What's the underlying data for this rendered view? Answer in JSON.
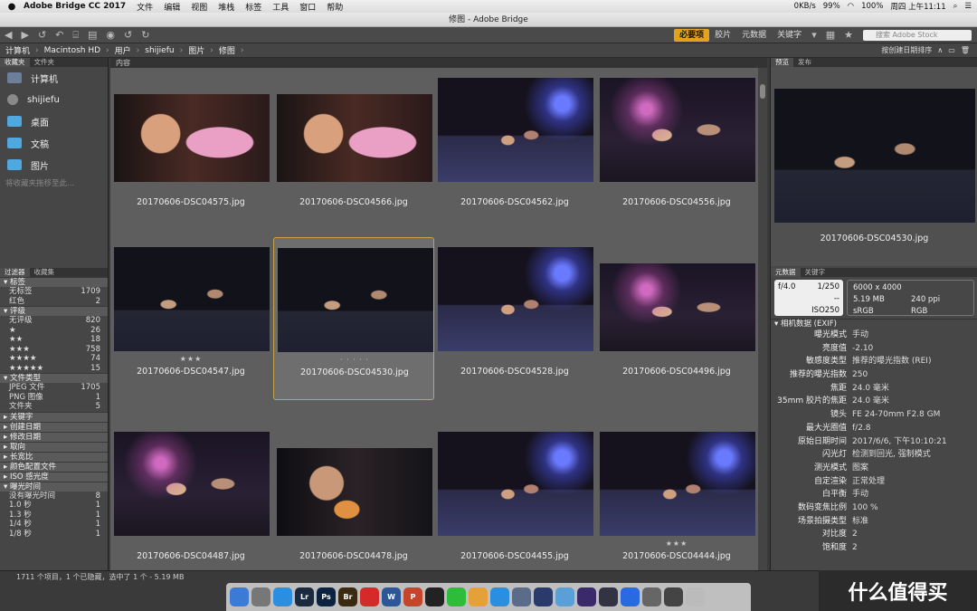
{
  "menubar": {
    "app": "Adobe Bridge CC 2017",
    "items": [
      "文件",
      "编辑",
      "视图",
      "堆栈",
      "标签",
      "工具",
      "窗口",
      "帮助"
    ],
    "net_speed": "0KB/s",
    "battery": "99%",
    "wifi_battery": "100%",
    "clock": "周四 上午11:11"
  },
  "window_title": "修图 - Adobe Bridge",
  "toolbar": {
    "workspaces": [
      "必要项",
      "胶片",
      "元数据",
      "关键字"
    ],
    "active_workspace": "必要项",
    "search_placeholder": "搜索 Adobe Stock",
    "sort_label": "按创建日期排序"
  },
  "breadcrumb": [
    "计算机",
    "Macintosh HD",
    "用户",
    "shijiefu",
    "图片",
    "修图"
  ],
  "favorites_panel": {
    "tabs": [
      "收藏夹",
      "文件夹"
    ],
    "items": [
      {
        "label": "计算机",
        "icon": "computer-icon"
      },
      {
        "label": "shijiefu",
        "icon": "user-icon"
      },
      {
        "label": "桌面",
        "icon": "folder-icon"
      },
      {
        "label": "文稿",
        "icon": "folder-icon"
      },
      {
        "label": "图片",
        "icon": "folder-icon"
      }
    ],
    "hint": "将收藏夹拖移至此..."
  },
  "filter_panel": {
    "tabs": [
      "过滤器",
      "收藏集"
    ],
    "sections": [
      {
        "title": "标签",
        "rows": [
          {
            "label": "无标签",
            "count": "1709"
          },
          {
            "label": "红色",
            "count": "2"
          }
        ]
      },
      {
        "title": "评级",
        "rows": [
          {
            "label": "无评级",
            "count": "820"
          },
          {
            "label": "★",
            "count": "26"
          },
          {
            "label": "★★",
            "count": "18"
          },
          {
            "label": "★★★",
            "count": "758"
          },
          {
            "label": "★★★★",
            "count": "74"
          },
          {
            "label": "★★★★★",
            "count": "15"
          }
        ]
      },
      {
        "title": "文件类型",
        "rows": [
          {
            "label": "JPEG 文件",
            "count": "1705"
          },
          {
            "label": "PNG 图像",
            "count": "1"
          },
          {
            "label": "文件夹",
            "count": "5"
          }
        ]
      },
      {
        "title": "关键字",
        "rows": []
      },
      {
        "title": "创建日期",
        "rows": []
      },
      {
        "title": "修改日期",
        "rows": []
      },
      {
        "title": "取向",
        "rows": []
      },
      {
        "title": "长宽比",
        "rows": []
      },
      {
        "title": "颜色配置文件",
        "rows": []
      },
      {
        "title": "ISO 感光度",
        "rows": []
      },
      {
        "title": "曝光时间",
        "rows": [
          {
            "label": "没有曝光时间",
            "count": "8"
          },
          {
            "label": "1.0 秒",
            "count": "1"
          },
          {
            "label": "1.3 秒",
            "count": "1"
          },
          {
            "label": "1/4 秒",
            "count": "1"
          },
          {
            "label": "1/8 秒",
            "count": "1"
          }
        ]
      }
    ]
  },
  "content": {
    "tab": "内容",
    "thumbnails": [
      {
        "name": "20170606-DSC04575.jpg",
        "rating": "",
        "selected": false,
        "scene": "closeup-pink"
      },
      {
        "name": "20170606-DSC04566.jpg",
        "rating": "",
        "selected": false,
        "scene": "closeup-pink"
      },
      {
        "name": "20170606-DSC04562.jpg",
        "rating": "",
        "selected": false,
        "scene": "ring-blue"
      },
      {
        "name": "20170606-DSC04556.jpg",
        "rating": "",
        "selected": false,
        "scene": "ring-purple"
      },
      {
        "name": "20170606-DSC04547.jpg",
        "rating": "★★★",
        "selected": false,
        "scene": "ring-dark"
      },
      {
        "name": "20170606-DSC04530.jpg",
        "rating": "· · · · ·",
        "selected": true,
        "scene": "ring-dark"
      },
      {
        "name": "20170606-DSC04528.jpg",
        "rating": "",
        "selected": false,
        "scene": "ring-blue"
      },
      {
        "name": "20170606-DSC04496.jpg",
        "rating": "",
        "selected": false,
        "scene": "ring-purple"
      },
      {
        "name": "20170606-DSC04487.jpg",
        "rating": "",
        "selected": false,
        "scene": "ring-purple"
      },
      {
        "name": "20170606-DSC04478.jpg",
        "rating": "",
        "selected": false,
        "scene": "closeup-dark"
      },
      {
        "name": "20170606-DSC04455.jpg",
        "rating": "",
        "selected": false,
        "scene": "ring-blue"
      },
      {
        "name": "20170606-DSC04444.jpg",
        "rating": "★★★",
        "selected": false,
        "scene": "ring-blue"
      }
    ]
  },
  "preview_panel": {
    "tabs": [
      "预览",
      "发布"
    ],
    "filename": "20170606-DSC04530.jpg"
  },
  "metadata_panel": {
    "tabs": [
      "元数据",
      "关键字"
    ],
    "aperture": "f/4.0",
    "shutter": "1/250",
    "iso": "ISO250",
    "dash": "--",
    "dimensions": "6000 x 4000",
    "size": "5.19 MB",
    "ppi": "240 ppi",
    "profile": "sRGB",
    "mode": "RGB",
    "section": "相机数据 (EXIF)",
    "rows": [
      {
        "k": "曝光模式",
        "v": "手动"
      },
      {
        "k": "亮度值",
        "v": "-2.10"
      },
      {
        "k": "敏感度类型",
        "v": "推荐的曝光指数 (REI)"
      },
      {
        "k": "推荐的曝光指数",
        "v": "250"
      },
      {
        "k": "焦距",
        "v": "24.0 毫米"
      },
      {
        "k": "35mm 胶片的焦距",
        "v": "24.0 毫米"
      },
      {
        "k": "镜头",
        "v": "FE 24-70mm F2.8 GM"
      },
      {
        "k": "最大光圈值",
        "v": "f/2.8"
      },
      {
        "k": "原始日期时间",
        "v": "2017/6/6, 下午10:10:21"
      },
      {
        "k": "闪光灯",
        "v": "检测到回光, 强制模式"
      },
      {
        "k": "测光模式",
        "v": "图案"
      },
      {
        "k": "自定渲染",
        "v": "正常处理"
      },
      {
        "k": "白平衡",
        "v": "手动"
      },
      {
        "k": "数码变焦比例",
        "v": "100 %"
      },
      {
        "k": "场景拍摄类型",
        "v": "标准"
      },
      {
        "k": "对比度",
        "v": "2"
      },
      {
        "k": "饱和度",
        "v": "2"
      }
    ]
  },
  "status": "1711 个项目，1 个已隐藏，选中了 1 个 - 5.19 MB",
  "dock": [
    {
      "label": "",
      "color": "#3b7bd6",
      "icon": "finder-icon"
    },
    {
      "label": "",
      "color": "#777",
      "icon": "launchpad-icon"
    },
    {
      "label": "",
      "color": "#2a8fe0",
      "icon": "safari-icon"
    },
    {
      "label": "Lr",
      "color": "#1b2a3f",
      "icon": "lightroom-icon"
    },
    {
      "label": "Ps",
      "color": "#0b2340",
      "icon": "photoshop-icon"
    },
    {
      "label": "Br",
      "color": "#3a2a10",
      "icon": "bridge-icon"
    },
    {
      "label": "",
      "color": "#d42a2a",
      "icon": "creative-cloud-icon"
    },
    {
      "label": "W",
      "color": "#2b5797",
      "icon": "word-icon"
    },
    {
      "label": "P",
      "color": "#c6442a",
      "icon": "powerpoint-icon"
    },
    {
      "label": "",
      "color": "#222",
      "icon": "qq-icon"
    },
    {
      "label": "",
      "color": "#2dbd3a",
      "icon": "wechat-icon"
    },
    {
      "label": "",
      "color": "#e6a03a",
      "icon": "photos-icon"
    },
    {
      "label": "",
      "color": "#2a8fe0",
      "icon": "app-store-icon"
    },
    {
      "label": "",
      "color": "#5b6b8a",
      "icon": "cloud-icon"
    },
    {
      "label": "",
      "color": "#2a3a6a",
      "icon": "vpn-icon"
    },
    {
      "label": "",
      "color": "#5aa0d6",
      "icon": "baidu-icon"
    },
    {
      "label": "",
      "color": "#3a2a6a",
      "icon": "imovie-icon"
    },
    {
      "label": "",
      "color": "#334",
      "icon": "stellar-icon"
    },
    {
      "label": "",
      "color": "#2a6ae0",
      "icon": "shield-icon"
    },
    {
      "label": "",
      "color": "#666",
      "icon": "preferences-icon"
    },
    {
      "label": "",
      "color": "#444",
      "icon": "screenshot-icon"
    },
    {
      "label": "",
      "color": "#bbb",
      "icon": "trash-icon"
    }
  ],
  "watermark": "什么值得买"
}
